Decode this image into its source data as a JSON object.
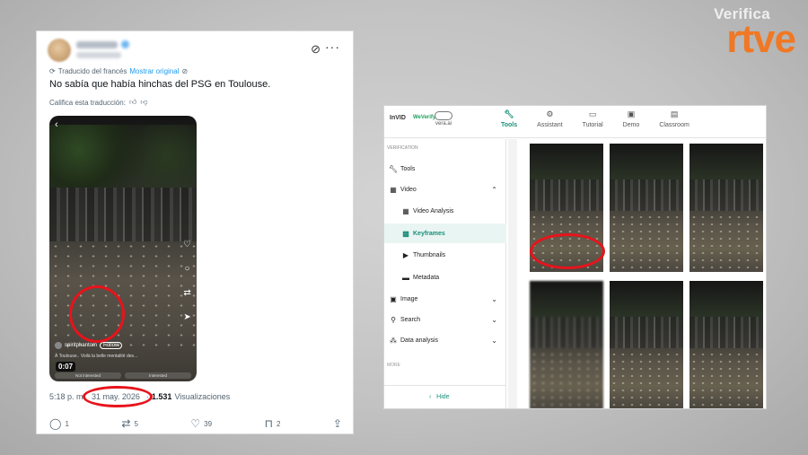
{
  "brand": {
    "sub": "Verifica",
    "main": "rtve",
    "color": "#f07824"
  },
  "tweet": {
    "translated_label": "Traducido del francés",
    "show_original": "Mostrar original",
    "text": "No sabía que había hinchas del PSG en Toulouse.",
    "rate_label": "Califica esta traducción:",
    "video": {
      "user": "spiritphantom",
      "follow": "Follow",
      "caption": "À Toulouse.. Voilà la belle mentalité des...",
      "duration": "0:07",
      "btn_not_interested": "Not interested",
      "btn_interested": "Interested"
    },
    "time": "5:18 p. m.",
    "separator": "·",
    "date": "31 may. 2026",
    "views_count": "1.531",
    "views_label": "Visualizaciones",
    "replies": "1",
    "reposts": "5",
    "likes": "39",
    "bookmarks": "2",
    "accent": "#1d9bf0"
  },
  "invid": {
    "logos": {
      "invid": "InVID",
      "weverify": "WeVerify",
      "vera": "vera.ai"
    },
    "tabs": [
      {
        "label": "Tools",
        "icon": "wrench-icon"
      },
      {
        "label": "Assistant",
        "icon": "robot-icon"
      },
      {
        "label": "Tutorial",
        "icon": "book-icon"
      },
      {
        "label": "Demo",
        "icon": "play-icon"
      },
      {
        "label": "Classroom",
        "icon": "classroom-icon"
      }
    ],
    "side_header": "VERIFICATION",
    "side_items": [
      {
        "label": "Tools",
        "icon": "wrench-icon"
      },
      {
        "label": "Video",
        "icon": "film-icon",
        "expanded": true
      },
      {
        "label": "Video Analysis",
        "icon": "grid-icon"
      },
      {
        "label": "Keyframes",
        "icon": "keyframes-icon",
        "active": true
      },
      {
        "label": "Thumbnails",
        "icon": "youtube-icon"
      },
      {
        "label": "Metadata",
        "icon": "doc-icon"
      },
      {
        "label": "Image",
        "icon": "image-icon"
      },
      {
        "label": "Search",
        "icon": "search-icon"
      },
      {
        "label": "Data analysis",
        "icon": "data-icon"
      }
    ],
    "side_more": "MORE",
    "hide_label": "Hide",
    "accent": "#1a8f7b"
  },
  "annotation_color": "#e8131b"
}
